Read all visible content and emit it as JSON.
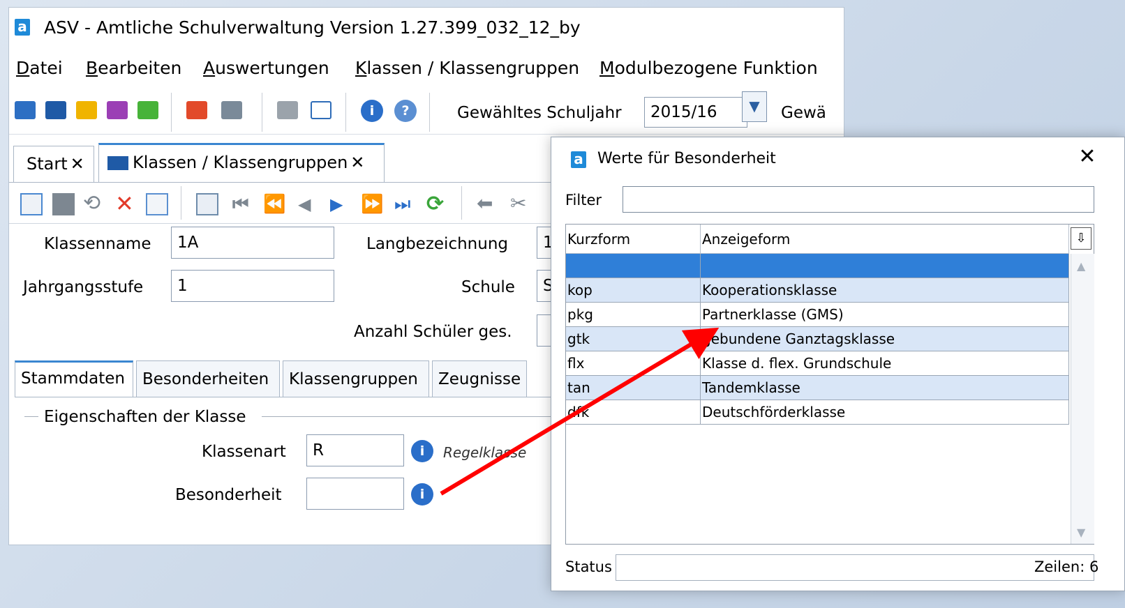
{
  "app": {
    "title": "ASV - Amtliche Schulverwaltung Version 1.27.399_032_12_by",
    "logo_letter": "a"
  },
  "menu": [
    "Datei",
    "Bearbeiten",
    "Auswertungen",
    "Klassen / Klassengruppen",
    "Modulbezogene Funktion"
  ],
  "toolbar": {
    "schuljahr_label": "Gewähltes Schuljahr",
    "schuljahr_value": "2015/16",
    "cut_label": "Gewä"
  },
  "tabs": [
    {
      "label": "Start",
      "close": "✕"
    },
    {
      "label": "Klassen / Klassengruppen",
      "close": "✕"
    }
  ],
  "form": {
    "klassenname_label": "Klassenname",
    "klassenname_value": "1A",
    "langbezeichnung_label": "Langbezeichnung",
    "langbezeichnung_value": "1",
    "jahrgangsstufe_label": "Jahrgangsstufe",
    "jahrgangsstufe_value": "1",
    "schule_label": "Schule",
    "schule_value": "S",
    "anzahl_label": "Anzahl Schüler ges.",
    "section_title": "Eigenschaften der Klasse",
    "klassenart_label": "Klassenart",
    "klassenart_value": "R",
    "klassenart_desc": "Regelklasse",
    "besonderheit_label": "Besonderheit",
    "besonderheit_value": ""
  },
  "subtabs": [
    "Stammdaten",
    "Besonderheiten",
    "Klassengruppen",
    "Zeugnisse"
  ],
  "dialog": {
    "title": "Werte für Besonderheit",
    "close": "✕",
    "filter_label": "Filter",
    "filter_value": "",
    "columns": [
      "Kurzform",
      "Anzeigeform"
    ],
    "rows": [
      {
        "kurz": "",
        "anzeige": ""
      },
      {
        "kurz": "kop",
        "anzeige": "Kooperationsklasse"
      },
      {
        "kurz": "pkg",
        "anzeige": "Partnerklasse (GMS)"
      },
      {
        "kurz": "gtk",
        "anzeige": "gebundene Ganztagsklasse"
      },
      {
        "kurz": "flx",
        "anzeige": "Klasse d. flex. Grundschule"
      },
      {
        "kurz": "tan",
        "anzeige": "Tandemklasse"
      },
      {
        "kurz": "dfk",
        "anzeige": "Deutschförderklasse"
      }
    ],
    "status_label": "Status",
    "zeilen_label": "Zeilen: 6"
  },
  "colors": {
    "accent": "#2f7fd8",
    "row_alt": "#d9e6f7",
    "arrow": "#ff0000"
  }
}
